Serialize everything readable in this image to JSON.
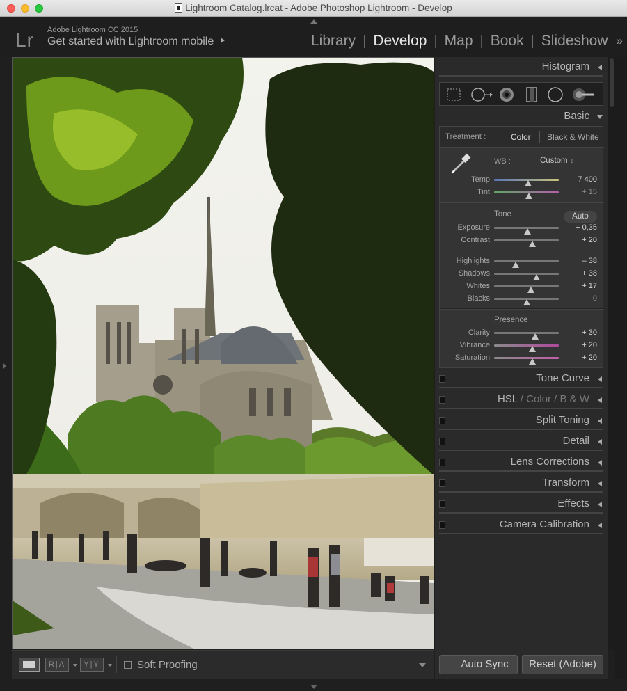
{
  "window": {
    "title": "Lightroom Catalog.lrcat - Adobe Photoshop Lightroom - Develop"
  },
  "header": {
    "logo": "Lr",
    "version": "Adobe Lightroom CC 2015",
    "mobile": "Get started with Lightroom mobile",
    "modules": [
      "Library",
      "Develop",
      "Map",
      "Book",
      "Slideshow"
    ],
    "active_module": "Develop",
    "more": "»"
  },
  "toolbar": {
    "ra_label": "R|A",
    "yy_label": "Y|Y",
    "soft_proofing": "Soft Proofing"
  },
  "panels": {
    "histogram": "Histogram",
    "basic": "Basic",
    "tone_curve": "Tone Curve",
    "hsl": "HSL",
    "color": "Color",
    "bw": "B & W",
    "split_toning": "Split Toning",
    "detail": "Detail",
    "lens_corrections": "Lens Corrections",
    "transform": "Transform",
    "effects": "Effects",
    "camera_calibration": "Camera Calibration"
  },
  "basic": {
    "treatment_label": "Treatment :",
    "treatment_color": "Color",
    "treatment_bw": "Black & White",
    "wb_label": "WB :",
    "wb_value": "Custom",
    "tone_label": "Tone",
    "auto_label": "Auto",
    "presence_label": "Presence",
    "sliders": {
      "temp": {
        "label": "Temp",
        "value": "7 400",
        "level": 0.53
      },
      "tint": {
        "label": "Tint",
        "value": "+ 15",
        "level": 0.54
      },
      "exposure": {
        "label": "Exposure",
        "value": "+ 0,35",
        "level": 0.52
      },
      "contrast": {
        "label": "Contrast",
        "value": "+ 20",
        "level": 0.59
      },
      "highlights": {
        "label": "Highlights",
        "value": "– 38",
        "level": 0.33
      },
      "shadows": {
        "label": "Shadows",
        "value": "+ 38",
        "level": 0.66
      },
      "whites": {
        "label": "Whites",
        "value": "+ 17",
        "level": 0.57
      },
      "blacks": {
        "label": "Blacks",
        "value": "0",
        "level": 0.5
      },
      "clarity": {
        "label": "Clarity",
        "value": "+ 30",
        "level": 0.63
      },
      "vibrance": {
        "label": "Vibrance",
        "value": "+ 20",
        "level": 0.59
      },
      "saturation": {
        "label": "Saturation",
        "value": "+ 20",
        "level": 0.59
      }
    }
  },
  "sync": {
    "auto_sync": "Auto Sync",
    "reset": "Reset (Adobe)"
  }
}
